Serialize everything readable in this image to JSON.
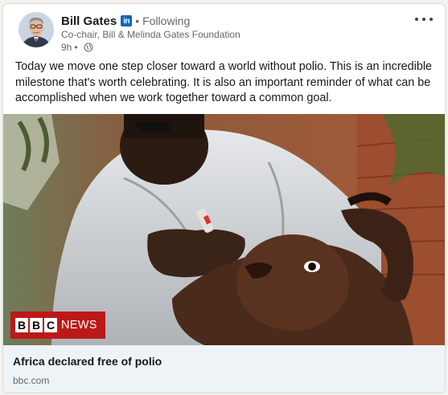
{
  "post": {
    "author": {
      "name": "Bill Gates",
      "badge": "in",
      "connection_dot": "•",
      "connection": "Following",
      "headline": "Co-chair, Bill & Melinda Gates Foundation",
      "time": "9h",
      "time_dot": "•"
    },
    "more_icon": "more-horizontal-icon",
    "globe_icon": "globe-icon",
    "text": "Today we move one step closer toward a world without polio. This is an incredible milestone that's worth celebrating. It is also an important reminder of what can be accomplished when we work together toward a common goal.",
    "media": {
      "logo_letters": [
        "B",
        "B",
        "C"
      ],
      "logo_word": "NEWS"
    },
    "link": {
      "title": "Africa declared free of polio",
      "domain": "bbc.com"
    }
  },
  "colors": {
    "linkedin_blue": "#0a66c2",
    "bbc_red": "#bb1919",
    "link_box_bg": "#eef3f8"
  }
}
